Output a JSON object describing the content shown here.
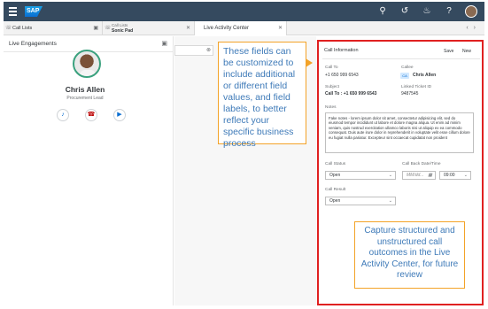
{
  "shell": {
    "logo": "SAP",
    "icons": [
      "search-icon",
      "history-icon",
      "bell-icon",
      "help-icon",
      "user-avatar"
    ]
  },
  "tabs": [
    {
      "label": "Call Lists",
      "icon": "headset-icon"
    },
    {
      "sub": "Call Lists",
      "label": "Sonic Pad",
      "icon": "headset-icon"
    },
    {
      "label": "Live Activity Center",
      "active": true
    }
  ],
  "left_panel": {
    "title": "Live Engagements",
    "contact_name": "Chris Allen",
    "contact_role": "Procurement Lead",
    "actions": [
      "microphone-icon",
      "hang-up-icon",
      "video-icon"
    ]
  },
  "callout_top": {
    "text": "These fields can be customized to include additional or different field values, and field labels, to better reflect your specific business process"
  },
  "call_info": {
    "title": "Call Information",
    "save_label": "Save",
    "new_label": "New",
    "call_to_label": "Call To",
    "call_to_value": "+1 650 999 6543",
    "callee_label": "Callee",
    "callee_initials": "CA",
    "callee_value": "Chris Allen",
    "subject_label": "Subject",
    "subject_value": "Call To : +1 650 999 6543",
    "linked_ticket_label": "Linked Ticket ID",
    "linked_ticket_value": "9487545",
    "notes_label": "Notes",
    "notes_value": "Fake notes - lorem ipsum dolor sit amet, consectetur adipisicing elit, sed do eiusmod tempor incididunt ut labore et dolore magna aliqua. Ut enim ad minim veniam, quis nostrud exercitation ullamco laboris nisi ut aliquip ex ea commodo consequat. Duis aute irure dolor in reprehenderit in voluptate velit esse cillum dolore eu fugiat nulla pariatur. Excepteur sint occaecat cupidatat non proident",
    "call_status_label": "Call Status",
    "call_status_value": "Open",
    "call_back_label": "Call Back Date/Time",
    "call_back_date_placeholder": "MM/dd...",
    "call_back_time": "09:00",
    "call_result_label": "Call Result",
    "call_result_value": "Open"
  },
  "callout_bottom": {
    "text": "Capture structured and unstructured call outcomes in the Live Activity Center, for future review"
  },
  "colors": {
    "shell": "#354a5f",
    "highlight_box": "#e02020",
    "callout_border": "#f3a328",
    "callout_text": "#3e7ab8"
  }
}
